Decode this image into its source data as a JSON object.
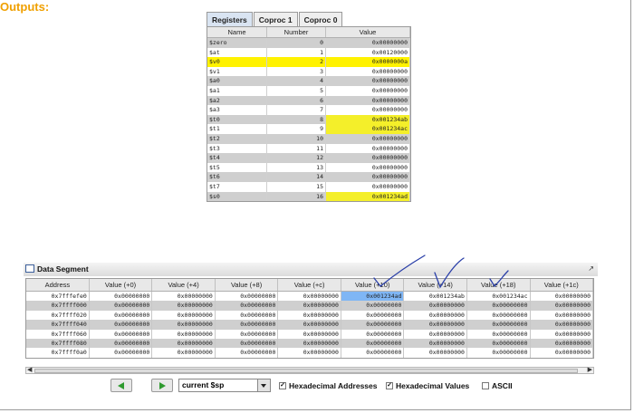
{
  "header": {
    "title": "Outputs:"
  },
  "registers": {
    "tabs": [
      {
        "label": "Registers",
        "active": true
      },
      {
        "label": "Coproc 1",
        "active": false
      },
      {
        "label": "Coproc 0",
        "active": false
      }
    ],
    "columns": [
      "Name",
      "Number",
      "Value"
    ],
    "rows": [
      {
        "name": "$zero",
        "number": "0",
        "value": "0x00000000",
        "highlight": "none"
      },
      {
        "name": "$at",
        "number": "1",
        "value": "0x00120000",
        "highlight": "none"
      },
      {
        "name": "$v0",
        "number": "2",
        "value": "0x0000000a",
        "highlight": "row"
      },
      {
        "name": "$v1",
        "number": "3",
        "value": "0x00000000",
        "highlight": "none"
      },
      {
        "name": "$a0",
        "number": "4",
        "value": "0x00000000",
        "highlight": "none"
      },
      {
        "name": "$a1",
        "number": "5",
        "value": "0x00000000",
        "highlight": "none"
      },
      {
        "name": "$a2",
        "number": "6",
        "value": "0x00000000",
        "highlight": "none"
      },
      {
        "name": "$a3",
        "number": "7",
        "value": "0x00000000",
        "highlight": "none"
      },
      {
        "name": "$t0",
        "number": "8",
        "value": "0x001234ab",
        "highlight": "value"
      },
      {
        "name": "$t1",
        "number": "9",
        "value": "0x001234ac",
        "highlight": "value"
      },
      {
        "name": "$t2",
        "number": "10",
        "value": "0x00000000",
        "highlight": "none"
      },
      {
        "name": "$t3",
        "number": "11",
        "value": "0x00000000",
        "highlight": "none"
      },
      {
        "name": "$t4",
        "number": "12",
        "value": "0x00000000",
        "highlight": "none"
      },
      {
        "name": "$t5",
        "number": "13",
        "value": "0x00000000",
        "highlight": "none"
      },
      {
        "name": "$t6",
        "number": "14",
        "value": "0x00000000",
        "highlight": "none"
      },
      {
        "name": "$t7",
        "number": "15",
        "value": "0x00000000",
        "highlight": "none"
      },
      {
        "name": "$s0",
        "number": "16",
        "value": "0x001234ad",
        "highlight": "value"
      }
    ]
  },
  "data_segment": {
    "title": "Data Segment",
    "columns": [
      "Address",
      "Value (+0)",
      "Value (+4)",
      "Value (+8)",
      "Value (+c)",
      "Value (+10)",
      "Value (+14)",
      "Value (+18)",
      "Value (+1c)"
    ],
    "rows": [
      {
        "address": "0x7fffefe0",
        "values": [
          "0x00000000",
          "0x00000000",
          "0x00000000",
          "0x00000000",
          "0x001234ad",
          "0x001234ab",
          "0x001234ac",
          "0x00000000"
        ],
        "selected_col": 4
      },
      {
        "address": "0x7ffff000",
        "values": [
          "0x00000000",
          "0x00000000",
          "0x00000000",
          "0x00000000",
          "0x00000000",
          "0x00000000",
          "0x00000000",
          "0x00000000"
        ],
        "selected_col": -1
      },
      {
        "address": "0x7ffff020",
        "values": [
          "0x00000000",
          "0x00000000",
          "0x00000000",
          "0x00000000",
          "0x00000000",
          "0x00000000",
          "0x00000000",
          "0x00000000"
        ],
        "selected_col": -1
      },
      {
        "address": "0x7ffff040",
        "values": [
          "0x00000000",
          "0x00000000",
          "0x00000000",
          "0x00000000",
          "0x00000000",
          "0x00000000",
          "0x00000000",
          "0x00000000"
        ],
        "selected_col": -1
      },
      {
        "address": "0x7ffff060",
        "values": [
          "0x00000000",
          "0x00000000",
          "0x00000000",
          "0x00000000",
          "0x00000000",
          "0x00000000",
          "0x00000000",
          "0x00000000"
        ],
        "selected_col": -1
      },
      {
        "address": "0x7ffff080",
        "values": [
          "0x00000000",
          "0x00000000",
          "0x00000000",
          "0x00000000",
          "0x00000000",
          "0x00000000",
          "0x00000000",
          "0x00000000"
        ],
        "selected_col": -1
      },
      {
        "address": "0x7ffff0a0",
        "values": [
          "0x00000000",
          "0x00000000",
          "0x00000000",
          "0x00000000",
          "0x00000000",
          "0x00000000",
          "0x00000000",
          "0x00000000"
        ],
        "selected_col": -1
      }
    ],
    "controls": {
      "segment_select": "current $sp",
      "hex_addresses_label": "Hexadecimal Addresses",
      "hex_addresses_checked": true,
      "hex_values_label": "Hexadecimal Values",
      "hex_values_checked": true,
      "ascii_label": "ASCII",
      "ascii_checked": false
    }
  },
  "colors": {
    "title_orange": "#f0a000",
    "highlight_yellow": "#fff200",
    "selection_blue": "#7fb6f5",
    "ink_blue": "#2a3fa8"
  }
}
